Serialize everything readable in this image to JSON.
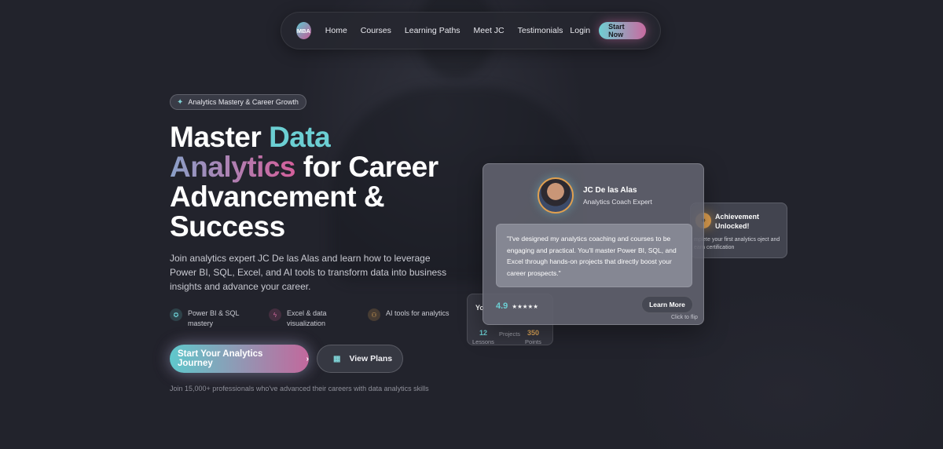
{
  "nav": {
    "logo": "MBA",
    "links": [
      "Home",
      "Courses",
      "Learning Paths",
      "Meet JC",
      "Testimonials"
    ],
    "login": "Login",
    "cta": "Start Now"
  },
  "hero": {
    "tag": "Analytics Mastery & Career Growth",
    "headline": {
      "w1": "Master ",
      "w2": "Data",
      "w3": "Analytics",
      "w4": " for Career Advancement & Success"
    },
    "subtitle": "Join analytics expert JC De las Alas and learn how to leverage Power BI, SQL, Excel, and AI tools to transform data into business insights and advance your career.",
    "features": [
      {
        "label": "Power BI & SQL mastery",
        "icon": "award-icon"
      },
      {
        "label": "Excel & data visualization",
        "icon": "bolt-icon"
      },
      {
        "label": "AI tools for analytics",
        "icon": "users-icon"
      }
    ],
    "cta_primary": "Start Your Analytics Journey",
    "cta_secondary": "View Plans",
    "social_proof": "Join 15,000+ professionals who've advanced their careers with data analytics skills"
  },
  "coach_card": {
    "name": "JC De las Alas",
    "role": "Analytics Coach Expert",
    "quote": "\"I've designed my analytics coaching and courses to be engaging and practical. You'll master Power BI, SQL, and Excel through hands-on projects that directly boost your career prospects.\"",
    "rating": "4.9",
    "stars": "★★★★★",
    "learn_more": "Learn More",
    "flip_hint": "Click to flip"
  },
  "achievement_card": {
    "title": "Achievement Unlocked!",
    "desc": "mplete your first analytics oject and earn certification"
  },
  "progress_card": {
    "title": "Yo",
    "stats": [
      {
        "value": "12",
        "label": "Lessons"
      },
      {
        "value": "",
        "label": "Projects"
      },
      {
        "value": "350",
        "label": "Points"
      }
    ]
  },
  "colors": {
    "background": "#22232c",
    "teal": "#6ccfd3",
    "pink": "#c96aa0",
    "amber": "#e0a050"
  }
}
